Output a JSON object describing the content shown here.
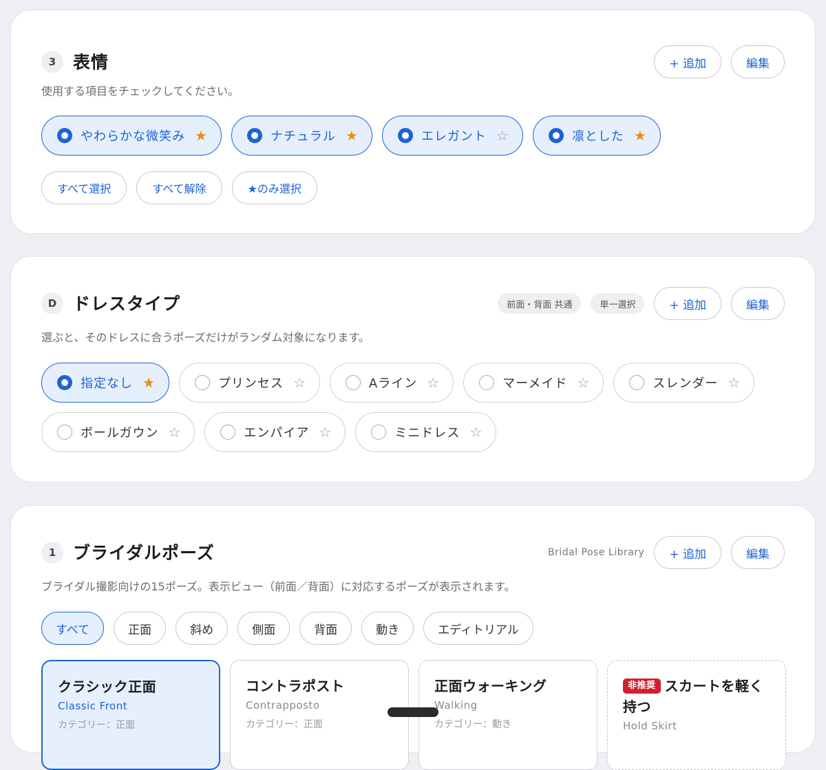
{
  "expression": {
    "number": "3",
    "title": "表情",
    "add_label": "+ 追加",
    "edit_label": "編集",
    "description": "使用する項目をチェックしてください。",
    "options": [
      {
        "label": "やわらかな微笑み",
        "selected": true,
        "star": "★",
        "starred": true
      },
      {
        "label": "ナチュラル",
        "selected": true,
        "star": "★",
        "starred": true
      },
      {
        "label": "エレガント",
        "selected": true,
        "star": "☆",
        "starred": false
      },
      {
        "label": "凛とした",
        "selected": true,
        "star": "★",
        "starred": true
      }
    ],
    "select_all": "すべて選択",
    "clear_all": "すべて解除",
    "select_starred": "★のみ選択"
  },
  "dress": {
    "number": "D",
    "title": "ドレスタイプ",
    "tag_shared": "前面・背面 共通",
    "tag_single": "単一選択",
    "add_label": "+ 追加",
    "edit_label": "編集",
    "description": "選ぶと、そのドレスに合うポーズだけがランダム対象になります。",
    "options": [
      {
        "label": "指定なし",
        "selected": true,
        "star": "★",
        "starred": true
      },
      {
        "label": "プリンセス",
        "selected": false,
        "star": "☆",
        "starred": false
      },
      {
        "label": "Aライン",
        "selected": false,
        "star": "☆",
        "starred": false
      },
      {
        "label": "マーメイド",
        "selected": false,
        "star": "☆",
        "starred": false
      },
      {
        "label": "スレンダー",
        "selected": false,
        "star": "☆",
        "starred": false
      },
      {
        "label": "ボールガウン",
        "selected": false,
        "star": "☆",
        "starred": false
      },
      {
        "label": "エンパイア",
        "selected": false,
        "star": "☆",
        "starred": false
      },
      {
        "label": "ミニドレス",
        "selected": false,
        "star": "☆",
        "starred": false
      }
    ]
  },
  "bridal": {
    "number": "1",
    "title": "ブライダルポーズ",
    "library_label": "Bridal Pose Library",
    "add_label": "+ 追加",
    "edit_label": "編集",
    "description": "ブライダル撮影向けの15ポーズ。表示ビュー（前面／背面）に対応するポーズが表示されます。",
    "filters": [
      "すべて",
      "正面",
      "斜め",
      "側面",
      "背面",
      "動き",
      "エディトリアル"
    ],
    "active_filter": "すべて",
    "poses": [
      {
        "title": "クラシック正面",
        "subtitle": "Classic Front",
        "category": "カテゴリー：正面",
        "selected": true,
        "badge": ""
      },
      {
        "title": "コントラポスト",
        "subtitle": "Contrapposto",
        "category": "カテゴリー：正面",
        "selected": false,
        "badge": ""
      },
      {
        "title": "正面ウォーキング",
        "subtitle": "Walking",
        "category": "カテゴリー：動き",
        "selected": false,
        "badge": ""
      },
      {
        "title": "スカートを軽く持つ",
        "subtitle": "Hold Skirt",
        "category": "",
        "selected": false,
        "badge": "非推奨"
      }
    ]
  },
  "colors": {
    "accent": "#1d63d6",
    "star": "#ec8c14",
    "badge": "#d21f2f",
    "background": "#efeff3"
  }
}
